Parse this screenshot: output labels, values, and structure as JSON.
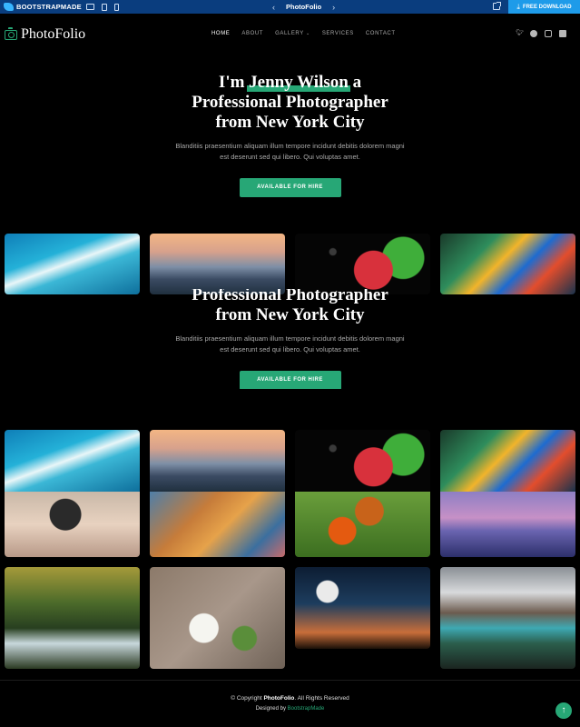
{
  "preview_bar": {
    "brand": "BOOTSTRAPMADE",
    "title": "PhotoFolio",
    "prev_arrow": "‹",
    "next_arrow": "›",
    "download_label": "FREE DOWNLOAD",
    "download_icon": "download-icon",
    "colors": {
      "bar": "#0a3d7e",
      "download": "#1e9be9"
    }
  },
  "header": {
    "logo_text": "PhotoFolio",
    "logo_icon": "camera-icon",
    "nav": [
      {
        "label": "HOME",
        "active": true
      },
      {
        "label": "ABOUT",
        "active": false
      },
      {
        "label": "GALLERY",
        "active": false,
        "dropdown": true
      },
      {
        "label": "SERVICES",
        "active": false
      },
      {
        "label": "CONTACT",
        "active": false
      }
    ],
    "socials": [
      "twitter-icon",
      "facebook-icon",
      "instagram-icon",
      "linkedin-icon"
    ]
  },
  "hero": {
    "title_prefix": "I'm",
    "name": "Jenny Wilson",
    "title_suffix": "a",
    "line2": "Professional Photographer",
    "line3": "from New York City",
    "description": "Blanditiis praesentium aliquam illum tempore incidunt debitis dolorem magni est deserunt sed qui libero. Qui voluptas amet.",
    "cta": "AVAILABLE FOR HIRE",
    "accent": "#27a776"
  },
  "gallery": [
    {
      "name": "surfing"
    },
    {
      "name": "city"
    },
    {
      "name": "strawberry"
    },
    {
      "name": "parrot"
    },
    {
      "name": "camera"
    },
    {
      "name": "hair"
    },
    {
      "name": "butterfly"
    },
    {
      "name": "boat"
    },
    {
      "name": "forest"
    },
    {
      "name": "food"
    },
    {
      "name": "moon"
    },
    {
      "name": "mountain"
    }
  ],
  "footer": {
    "copyright_prefix": "© Copyright",
    "copyright_brand": "PhotoFolio",
    "copyright_suffix": ". All Rights Reserved",
    "designed_by": "Designed by",
    "designer": "BootstrapMade"
  },
  "scroll_top_icon": "arrow-up-icon"
}
